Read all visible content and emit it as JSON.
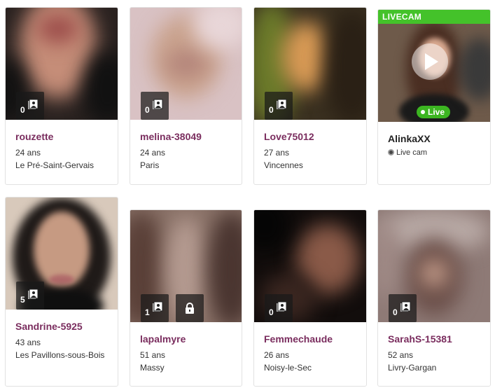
{
  "profiles_row1": [
    {
      "username": "rouzette",
      "age": "24 ans",
      "city": "Le Pré-Saint-Gervais",
      "photo_count": "0"
    },
    {
      "username": "melina-38049",
      "age": "24 ans",
      "city": "Paris",
      "photo_count": "0"
    },
    {
      "username": "Love75012",
      "age": "27 ans",
      "city": "Vincennes",
      "photo_count": "0"
    }
  ],
  "livecam": {
    "banner": "LIVECAM",
    "live_label": "Live",
    "username": "AlinkaXX",
    "sub_label": "Live cam"
  },
  "profiles_row2": [
    {
      "username": "Sandrine-5925",
      "age": "43 ans",
      "city": "Les Pavillons-sous-Bois",
      "photo_count": "5"
    },
    {
      "username": "lapalmyre",
      "age": "51 ans",
      "city": "Massy",
      "photo_count": "1"
    },
    {
      "username": "Femmechaude",
      "age": "26 ans",
      "city": "Noisy-le-Sec",
      "photo_count": "0"
    },
    {
      "username": "SarahS-15381",
      "age": "52 ans",
      "city": "Livry-Gargan",
      "photo_count": "0"
    }
  ],
  "colors": {
    "username": "#7a2d5e",
    "livecam_green": "#44c22a",
    "card_border": "#e2e2e2"
  },
  "icons": [
    "photo-stack-icon",
    "lock-icon",
    "play-icon",
    "webcam-icon"
  ]
}
